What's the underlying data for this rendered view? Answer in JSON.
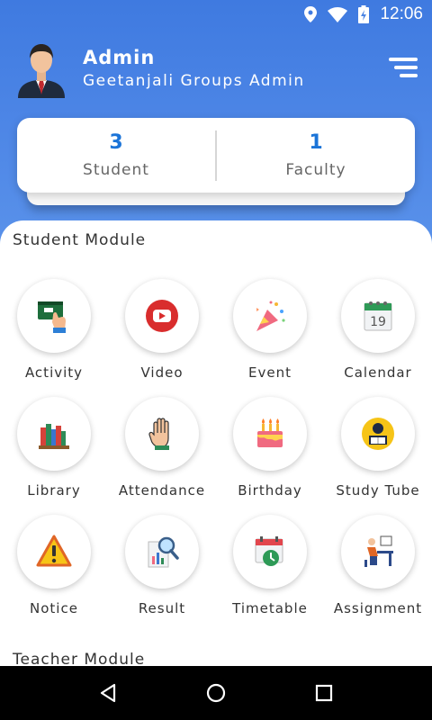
{
  "status_bar": {
    "time": "12:06",
    "icons": [
      "location-icon",
      "wifi-icon",
      "battery-icon"
    ]
  },
  "profile": {
    "name": "Admin",
    "subtitle": "Geetanjali Groups Admin"
  },
  "stats": [
    {
      "count": "3",
      "label": "Student"
    },
    {
      "count": "1",
      "label": "Faculty"
    }
  ],
  "student_module": {
    "title": "Student Module",
    "items": [
      {
        "label": "Activity",
        "icon": "activity-icon"
      },
      {
        "label": "Video",
        "icon": "video-icon"
      },
      {
        "label": "Event",
        "icon": "event-icon"
      },
      {
        "label": "Calendar",
        "icon": "calendar-icon"
      },
      {
        "label": "Library",
        "icon": "library-icon"
      },
      {
        "label": "Attendance",
        "icon": "attendance-icon"
      },
      {
        "label": "Birthday",
        "icon": "birthday-icon"
      },
      {
        "label": "Study Tube",
        "icon": "study-tube-icon"
      },
      {
        "label": "Notice",
        "icon": "notice-icon"
      },
      {
        "label": "Result",
        "icon": "result-icon"
      },
      {
        "label": "Timetable",
        "icon": "timetable-icon"
      },
      {
        "label": "Assignment",
        "icon": "assignment-icon"
      }
    ]
  },
  "calendar_icon_day": "19",
  "teacher_module": {
    "title": "Teacher Module"
  },
  "colors": {
    "header_gradient_top": "#3f7ae0",
    "header_gradient_bottom": "#5a92ea",
    "stat_count": "#1b74d8",
    "nav_bar": "#000000"
  }
}
